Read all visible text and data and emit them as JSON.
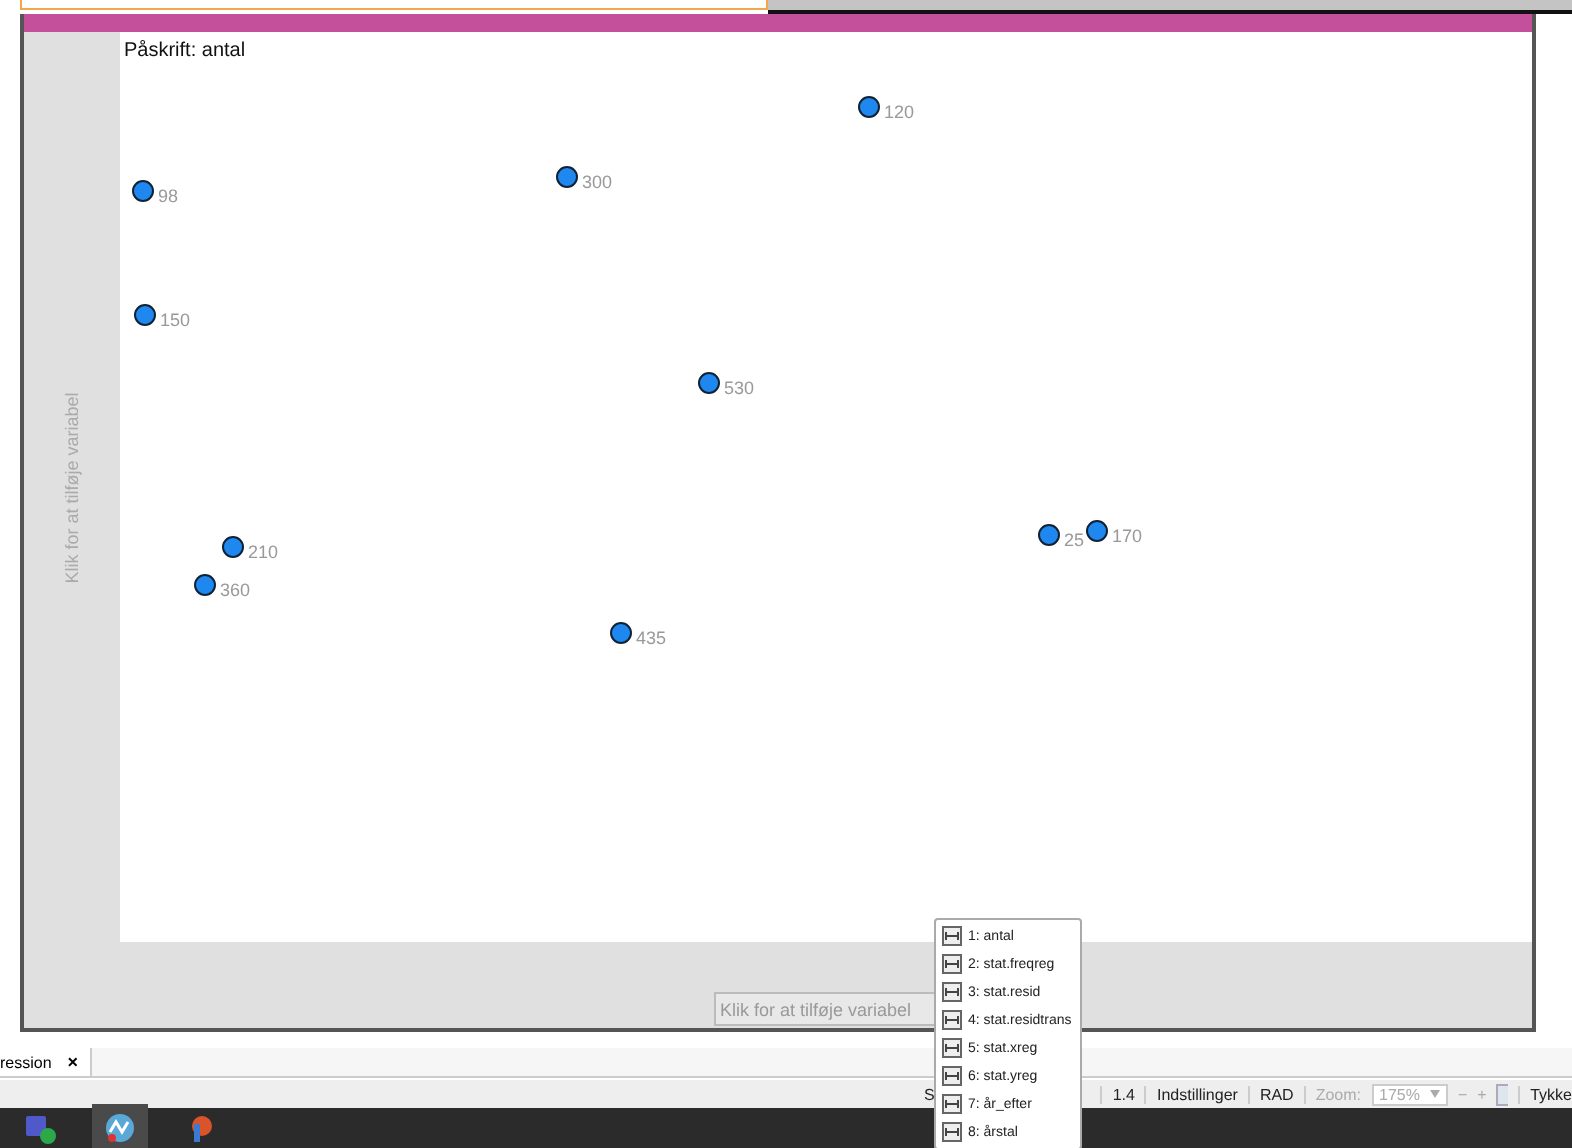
{
  "caption": "Påskrift: antal",
  "points": [
    {
      "label": "120"
    },
    {
      "label": "98"
    },
    {
      "label": "300"
    },
    {
      "label": "150"
    },
    {
      "label": "530"
    },
    {
      "label": "210"
    },
    {
      "label": "360"
    },
    {
      "label": "435"
    },
    {
      "label": "25"
    },
    {
      "label": "170"
    }
  ],
  "y_axis_hint": "Klik for at tilføje variabel",
  "x_axis_field": {
    "placeholder": "Klik for at tilføje variabel"
  },
  "variable_menu": [
    {
      "label": "1: antal"
    },
    {
      "label": "2: stat.freqreg"
    },
    {
      "label": "3: stat.resid"
    },
    {
      "label": "4: stat.residtrans"
    },
    {
      "label": "5: stat.xreg"
    },
    {
      "label": "6: stat.yreg"
    },
    {
      "label": "7: år_efter"
    },
    {
      "label": "8: årstal"
    }
  ],
  "tab": {
    "label": "ression",
    "close": "×"
  },
  "status_bar": {
    "left": "S",
    "version": "1.4",
    "settings": "Indstillinger",
    "angle": "RAD",
    "zoom_label": "Zoom:",
    "zoom_value": "175%",
    "minus": "−",
    "plus": "+",
    "last": "Tykke"
  }
}
